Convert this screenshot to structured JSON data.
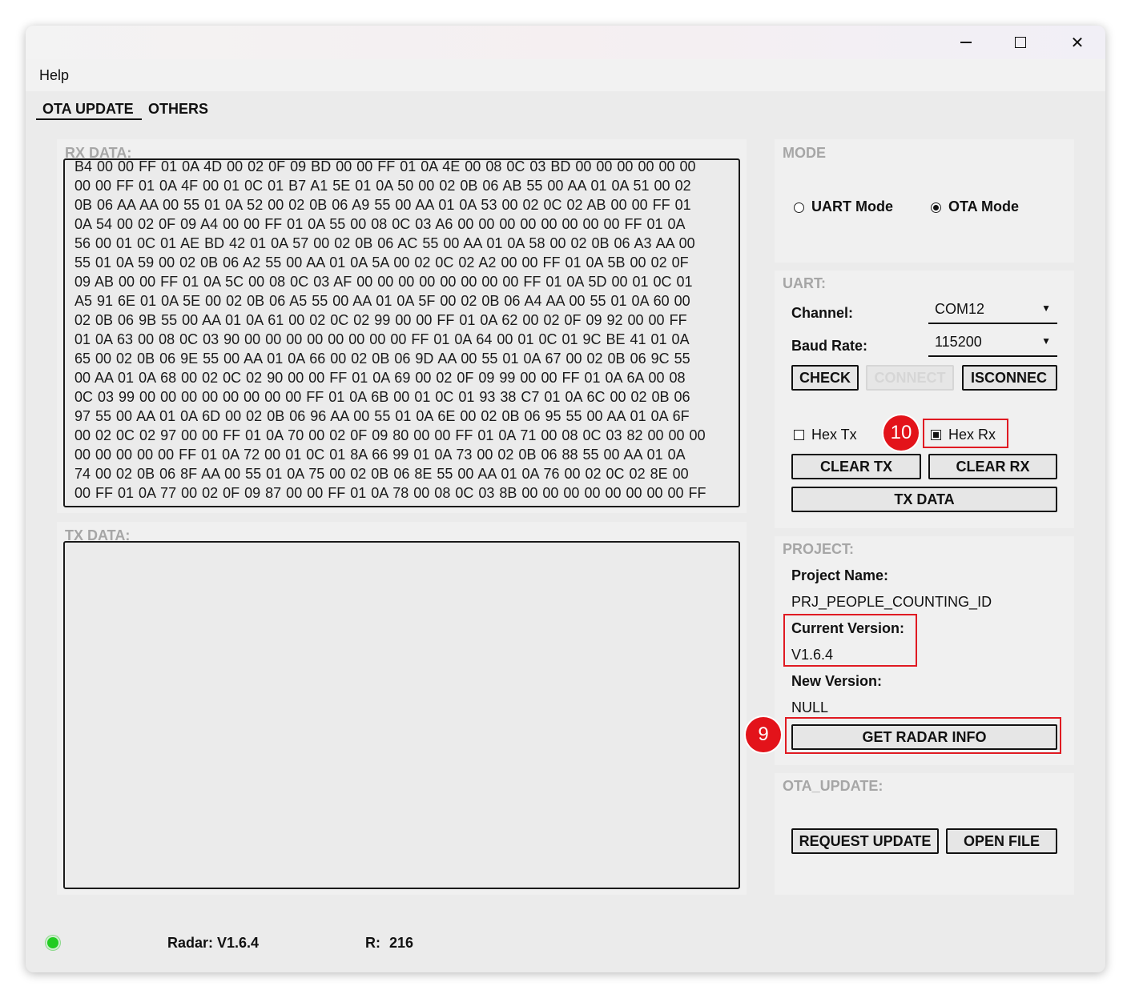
{
  "window": {
    "controls": {
      "minimize_icon": "—",
      "maximize_icon": "☐",
      "close_icon": "✕"
    }
  },
  "menu": {
    "help": "Help"
  },
  "tabs": [
    {
      "label": "OTA UPDATE",
      "active": true
    },
    {
      "label": "OTHERS",
      "active": false
    }
  ],
  "rx": {
    "title": "RX DATA:",
    "lines": [
      "B4 00 00 FF 01 0A 4D 00 02 0F 09 BD 00 00 FF 01 0A 4E 00 08 0C 03 BD 00 00 00 00 00 00",
      "00 00 FF 01 0A 4F 00 01 0C 01 B7 A1 5E 01 0A 50 00 02 0B 06 AB 55 00 AA 01 0A 51 00 02",
      "0B 06 AA AA 00 55 01 0A 52 00 02 0B 06 A9 55 00 AA 01 0A 53 00 02 0C 02 AB 00 00 FF 01",
      "0A 54 00 02 0F 09 A4 00 00 FF 01 0A 55 00 08 0C 03 A6 00 00 00 00 00 00 00 00 FF 01 0A",
      "56 00 01 0C 01 AE BD 42 01 0A 57 00 02 0B 06 AC 55 00 AA 01 0A 58 00 02 0B 06 A3 AA 00",
      "55 01 0A 59 00 02 0B 06 A2 55 00 AA 01 0A 5A 00 02 0C 02 A2 00 00 FF 01 0A 5B 00 02 0F",
      "09 AB 00 00 FF 01 0A 5C 00 08 0C 03 AF 00 00 00 00 00 00 00 00 FF 01 0A 5D 00 01 0C 01",
      "A5 91 6E 01 0A 5E 00 02 0B 06 A5 55 00 AA 01 0A 5F 00 02 0B 06 A4 AA 00 55 01 0A 60 00",
      "02 0B 06 9B 55 00 AA 01 0A 61 00 02 0C 02 99 00 00 FF 01 0A 62 00 02 0F 09 92 00 00 FF",
      "01 0A 63 00 08 0C 03 90 00 00 00 00 00 00 00 00 FF 01 0A 64 00 01 0C 01 9C BE 41 01 0A",
      "65 00 02 0B 06 9E 55 00 AA 01 0A 66 00 02 0B 06 9D AA 00 55 01 0A 67 00 02 0B 06 9C 55",
      "00 AA 01 0A 68 00 02 0C 02 90 00 00 FF 01 0A 69 00 02 0F 09 99 00 00 FF 01 0A 6A 00 08",
      "0C 03 99 00 00 00 00 00 00 00 00 FF 01 0A 6B 00 01 0C 01 93 38 C7 01 0A 6C 00 02 0B 06",
      "97 55 00 AA 01 0A 6D 00 02 0B 06 96 AA 00 55 01 0A 6E 00 02 0B 06 95 55 00 AA 01 0A 6F",
      "00 02 0C 02 97 00 00 FF 01 0A 70 00 02 0F 09 80 00 00 FF 01 0A 71 00 08 0C 03 82 00 00 00",
      "00 00 00 00 00 FF 01 0A 72 00 01 0C 01 8A 66 99 01 0A 73 00 02 0B 06 88 55 00 AA 01 0A",
      "74 00 02 0B 06 8F AA 00 55 01 0A 75 00 02 0B 06 8E 55 00 AA 01 0A 76 00 02 0C 02 8E 00",
      "00 FF 01 0A 77 00 02 0F 09 87 00 00 FF 01 0A 78 00 08 0C 03 8B 00 00 00 00 00 00 00 00 FF"
    ]
  },
  "tx": {
    "title": "TX DATA:",
    "value": ""
  },
  "mode": {
    "title": "MODE",
    "uart_label": "UART Mode",
    "ota_label": "OTA Mode",
    "selected": "OTA Mode"
  },
  "uart": {
    "title": "UART:",
    "channel_label": "Channel:",
    "channel_value": "COM12",
    "baud_label": "Baud Rate:",
    "baud_value": "115200",
    "check_label": "CHECK",
    "connect_label": "CONNECT",
    "disconnect_label": "ISCONNEC",
    "hex_tx_label": "Hex Tx",
    "hex_tx_checked": false,
    "hex_rx_label": "Hex Rx",
    "hex_rx_checked": true,
    "clear_tx_label": "CLEAR TX",
    "clear_rx_label": "CLEAR RX",
    "tx_data_label": "TX DATA"
  },
  "project": {
    "title": "PROJECT:",
    "name_label": "Project Name:",
    "name_value": "PRJ_PEOPLE_COUNTING_ID",
    "current_label": "Current Version:",
    "current_value": "V1.6.4",
    "new_label": "New Version:",
    "new_value": "NULL",
    "get_info_label": "GET RADAR INFO"
  },
  "ota_update": {
    "title": "OTA_UPDATE:",
    "request_label": "REQUEST UPDATE",
    "open_label": "OPEN FILE"
  },
  "status": {
    "radar_label": "Radar:",
    "radar_value": "V1.6.4",
    "r_label": "R:",
    "r_value": "216",
    "indicator_color": "#22cc22"
  },
  "annotations": {
    "callout_9": "9",
    "callout_10": "10",
    "color": "#e3131a"
  }
}
